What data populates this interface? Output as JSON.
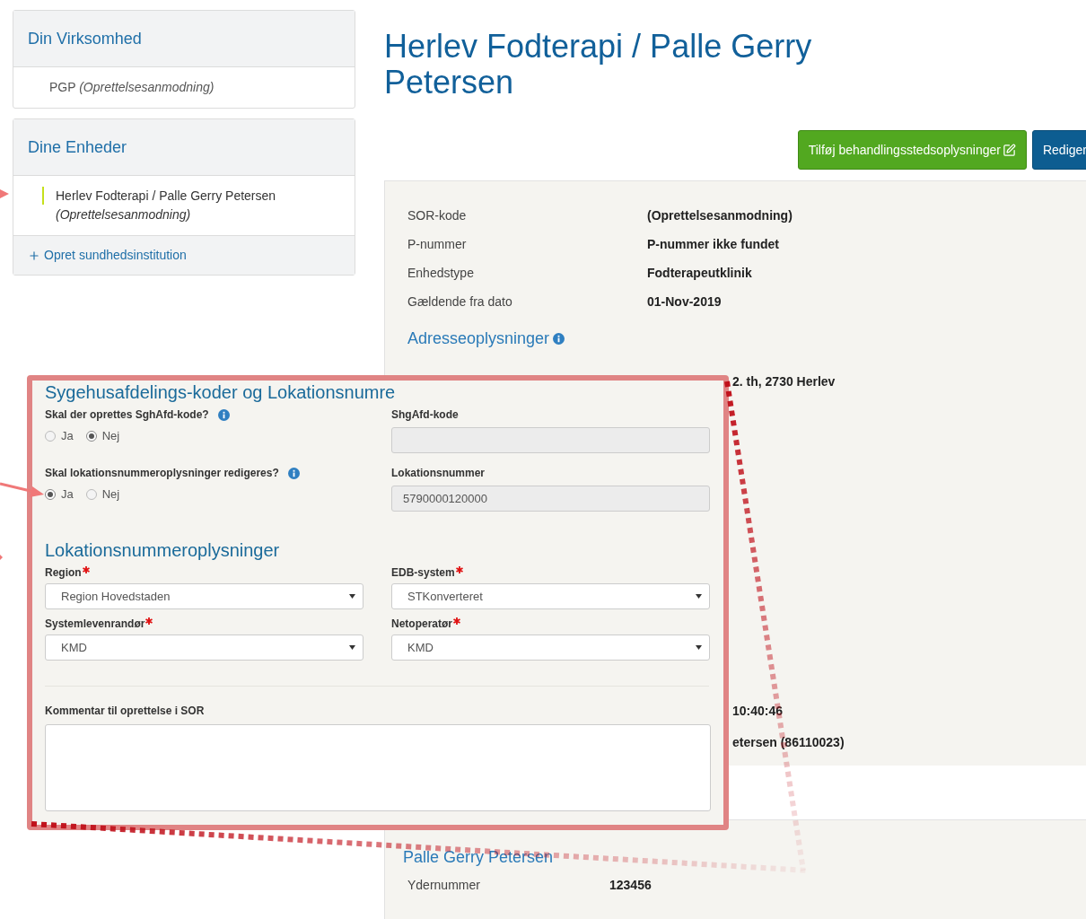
{
  "sidebar": {
    "sections": [
      {
        "title": "Din Virksomhed",
        "items": [
          {
            "name": "PGP",
            "status": "(Oprettelsesanmodning)",
            "selected": false
          }
        ]
      },
      {
        "title": "Dine Enheder",
        "items": [
          {
            "name": "Herlev Fodterapi / Palle Gerry Petersen",
            "status": "(Oprettelsesanmodning)",
            "selected": true
          }
        ]
      }
    ],
    "add_link": "Opret sundhedsinstitution"
  },
  "page_title": "Herlev Fodterapi / Palle Gerry Petersen",
  "buttons": [
    {
      "label": "Tilføj behandlingsstedsoplysninger",
      "kind": "success"
    },
    {
      "label": "Rediger",
      "kind": "primary"
    }
  ],
  "details": [
    {
      "label": "SOR-kode",
      "value": "(Oprettelsesanmodning)"
    },
    {
      "label": "P-nummer",
      "value": "P-nummer ikke fundet"
    },
    {
      "label": "Enhedstype",
      "value": "Fodterapeutklinik"
    },
    {
      "label": "Gældende fra dato",
      "value": "01-Nov-2019"
    }
  ],
  "address_heading": "Adresseoplysninger",
  "address_fragments": [
    "2. th, 2730 Herlev",
    "10:40:46",
    "etersen (86110023)"
  ],
  "person": {
    "heading": "Palle Gerry Petersen",
    "details": [
      {
        "label": "Ydernummer",
        "value": "123456"
      }
    ]
  },
  "overlay": {
    "title": "Sygehusafdelings-koder og Lokationsnumre",
    "questions": [
      {
        "label": "Skal der oprettes SghAfd-kode?",
        "options": [
          {
            "label": "Ja",
            "selected": false
          },
          {
            "label": "Nej",
            "selected": true
          }
        ],
        "field": {
          "label": "ShgAfd-kode",
          "disabled": true
        }
      },
      {
        "label": "Skal lokationsnummeroplysninger redigeres?",
        "options": [
          {
            "label": "Ja",
            "selected": true
          },
          {
            "label": "Nej",
            "selected": false
          }
        ],
        "field": {
          "label": "Lokationsnummer",
          "value": "5790000120000",
          "disabled": true
        }
      }
    ],
    "section_title": "Lokationsnummeroplysninger",
    "selects": [
      {
        "label": "Region",
        "required": true,
        "value": "Region Hovedstaden"
      },
      {
        "label": "EDB-system",
        "required": true,
        "value": "STKonverteret"
      },
      {
        "label": "Systemlevenrandør",
        "required": true,
        "value": "KMD"
      },
      {
        "label": "Netoperatør",
        "required": true,
        "value": "KMD"
      }
    ],
    "comment_label": "Kommentar til oprettelse i SOR"
  }
}
